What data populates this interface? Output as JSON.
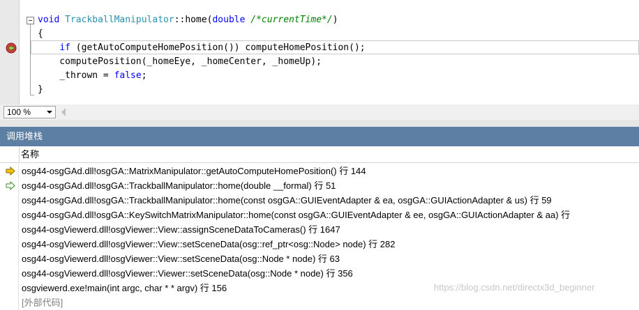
{
  "editor": {
    "lines": [
      {
        "parts": [
          [
            "kw",
            "void"
          ],
          [
            "",
            ""
          ],
          [
            "ty",
            "TrackballManipulator"
          ],
          [
            "",
            "::home("
          ],
          [
            "kw",
            "double"
          ],
          [
            "",
            " "
          ],
          [
            "cm",
            "/*currentTime*/"
          ],
          [
            "",
            ")"
          ]
        ]
      },
      {
        "parts": [
          [
            "",
            "{"
          ]
        ]
      },
      {
        "parts": [
          [
            "",
            "    "
          ],
          [
            "kw",
            "if"
          ],
          [
            "",
            " (getAutoComputeHomePosition()) computeHomePosition();"
          ]
        ]
      },
      {
        "parts": [
          [
            "",
            "    computePosition(_homeEye, _homeCenter, _homeUp);"
          ]
        ]
      },
      {
        "parts": [
          [
            "",
            "    _thrown = "
          ],
          [
            "kw",
            "false"
          ],
          [
            "",
            ";"
          ]
        ]
      },
      {
        "parts": [
          [
            "",
            "}"
          ]
        ]
      }
    ]
  },
  "zoom": {
    "value": "100 %"
  },
  "callstack": {
    "title": "调用堆栈",
    "column_name": "名称",
    "rows": [
      {
        "text": "osg44-osgGAd.dll!osgGA::MatrixManipulator::getAutoComputeHomePosition() 行 144",
        "icon": "current-frame-arrow-icon"
      },
      {
        "text": "osg44-osgGAd.dll!osgGA::TrackballManipulator::home(double __formal) 行 51",
        "icon": "return-frame-arrow-icon"
      },
      {
        "text": "osg44-osgGAd.dll!osgGA::TrackballManipulator::home(const osgGA::GUIEventAdapter & ea, osgGA::GUIActionAdapter & us) 行 59",
        "icon": ""
      },
      {
        "text": "osg44-osgGAd.dll!osgGA::KeySwitchMatrixManipulator::home(const osgGA::GUIEventAdapter & ee, osgGA::GUIActionAdapter & aa) 行",
        "icon": ""
      },
      {
        "text": "osg44-osgViewerd.dll!osgViewer::View::assignSceneDataToCameras() 行 1647",
        "icon": ""
      },
      {
        "text": "osg44-osgViewerd.dll!osgViewer::View::setSceneData(osg::ref_ptr<osg::Node> node) 行 282",
        "icon": ""
      },
      {
        "text": "osg44-osgViewerd.dll!osgViewer::View::setSceneData(osg::Node * node) 行 63",
        "icon": ""
      },
      {
        "text": "osg44-osgViewerd.dll!osgViewer::Viewer::setSceneData(osg::Node * node) 行 356",
        "icon": ""
      },
      {
        "text": "osgviewerd.exe!main(int argc, char * * argv) 行 156",
        "icon": ""
      },
      {
        "text": "[外部代码]",
        "icon": ""
      }
    ]
  },
  "watermark": "https://blog.csdn.net/directx3d_beginner",
  "colors": {
    "panel_title_bg": "#5c7fa3",
    "keyword": "#0000ff",
    "type": "#2b91af",
    "comment": "#008000",
    "arrow": "#f2c400"
  }
}
